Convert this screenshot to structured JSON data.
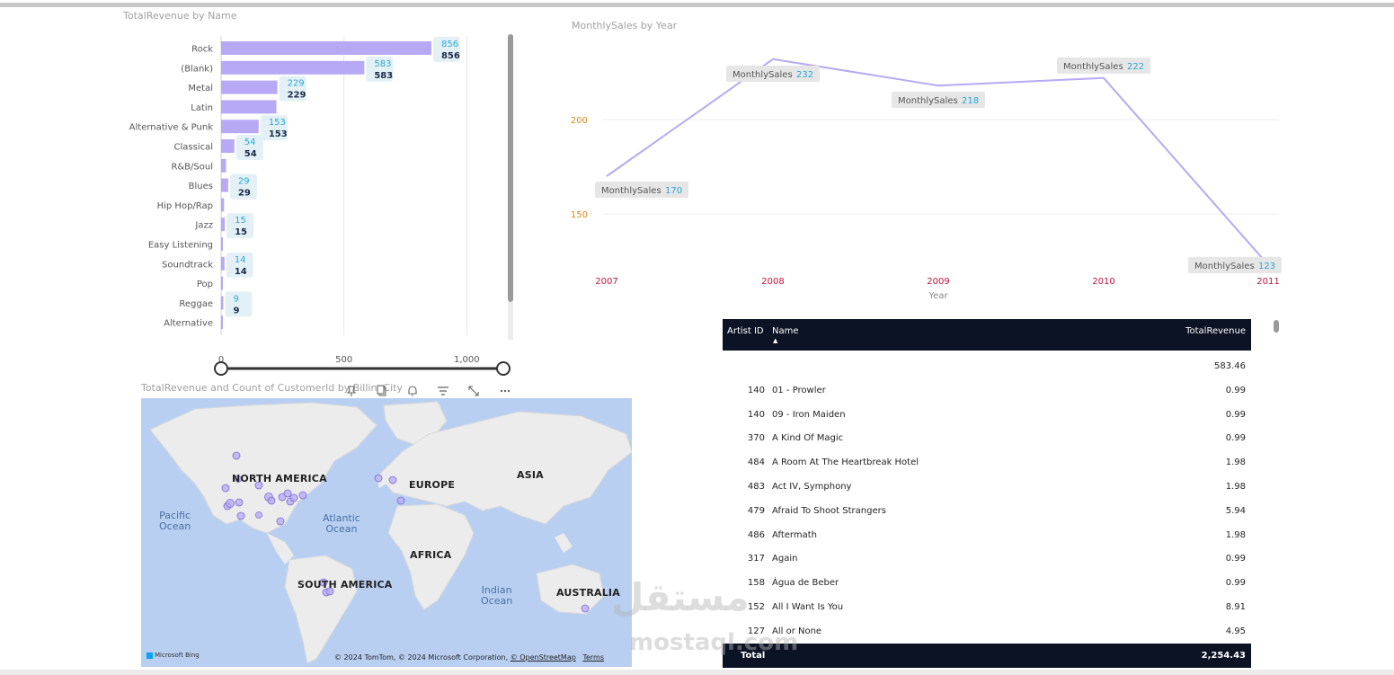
{
  "bar_chart": {
    "title": "TotalRevenue by Name",
    "chart_data": {
      "type": "bar",
      "orientation": "horizontal",
      "categories": [
        "Rock",
        "(Blank)",
        "Metal",
        "Latin",
        "Alternative & Punk",
        "Classical",
        "R&B/Soul",
        "Blues",
        "Hip Hop/Rap",
        "Jazz",
        "Easy Listening",
        "Soundtrack",
        "Pop",
        "Reggae",
        "Alternative"
      ],
      "values": [
        856,
        583,
        229,
        225,
        153,
        54,
        20,
        29,
        12,
        15,
        6,
        14,
        5,
        9,
        4
      ],
      "data_labels": [
        "856",
        "583",
        "229",
        "",
        "153",
        "54",
        "",
        "29",
        "",
        "15",
        "",
        "14",
        "",
        "9",
        ""
      ],
      "xlim": [
        0,
        1200
      ],
      "x_ticks": [
        "0",
        "500",
        "1,000"
      ],
      "color": "#b7a9f5",
      "label_box_color": "#e3f1f7",
      "label_top_color": "#2aa6d8",
      "label_bottom_color": "#1b2a4a"
    }
  },
  "line_chart": {
    "title": "MonthlySales by Year",
    "chart_data": {
      "type": "line",
      "x": [
        "2007",
        "2008",
        "2009",
        "2010",
        "2011"
      ],
      "series": [
        {
          "name": "MonthlySales",
          "values": [
            170,
            232,
            218,
            222,
            123
          ]
        }
      ],
      "xlabel": "Year",
      "y_ticks": [
        "200",
        "150"
      ],
      "ylim": [
        120,
        240
      ],
      "tooltip_label": "MonthlySales",
      "color": "#b7a9f5",
      "x_tick_color": "#c0143c",
      "y_tick_color": "#d68a1a"
    }
  },
  "map": {
    "title": "TotalRevenue and Count of CustomerId by BillingCity",
    "continents": [
      "NORTH AMERICA",
      "EUROPE",
      "ASIA",
      "AFRICA",
      "SOUTH AMERICA",
      "AUSTRALIA"
    ],
    "oceans": {
      "pacific": "Pacific\nOcean",
      "atlantic": "Atlantic\nOcean",
      "indian": "Indian\nOcean"
    },
    "attribution": "© 2024 TomTom, © 2024 Microsoft Corporation,",
    "osm_link": "© OpenStreetMap",
    "terms": "Terms",
    "bing": "Microsoft Bing",
    "icons": [
      "pin-icon",
      "copy-icon",
      "bell-icon",
      "filter-icon",
      "expand-icon",
      "more-options-icon"
    ]
  },
  "table": {
    "headers": {
      "artist_id": "Artist ID",
      "name": "Name",
      "revenue": "TotalRevenue"
    },
    "rows": [
      {
        "id": "",
        "name": "",
        "rev": "583.46"
      },
      {
        "id": "140",
        "name": "01 - Prowler",
        "rev": "0.99"
      },
      {
        "id": "140",
        "name": "09 - Iron Maiden",
        "rev": "0.99"
      },
      {
        "id": "370",
        "name": "A Kind Of Magic",
        "rev": "0.99"
      },
      {
        "id": "484",
        "name": "A Room At The Heartbreak Hotel",
        "rev": "1.98"
      },
      {
        "id": "483",
        "name": "Act IV, Symphony",
        "rev": "1.98"
      },
      {
        "id": "479",
        "name": "Afraid To Shoot Strangers",
        "rev": "5.94"
      },
      {
        "id": "486",
        "name": "Aftermath",
        "rev": "1.98"
      },
      {
        "id": "317",
        "name": "Again",
        "rev": "0.99"
      },
      {
        "id": "158",
        "name": "Água de Beber",
        "rev": "0.99"
      },
      {
        "id": "152",
        "name": "All I Want Is You",
        "rev": "8.91"
      },
      {
        "id": "127",
        "name": "All or None",
        "rev": "4.95"
      }
    ],
    "total_label": "Total",
    "total_value": "2,254.43"
  },
  "watermark": {
    "arabic": "مستقل",
    "latin": "mostaql.com"
  }
}
